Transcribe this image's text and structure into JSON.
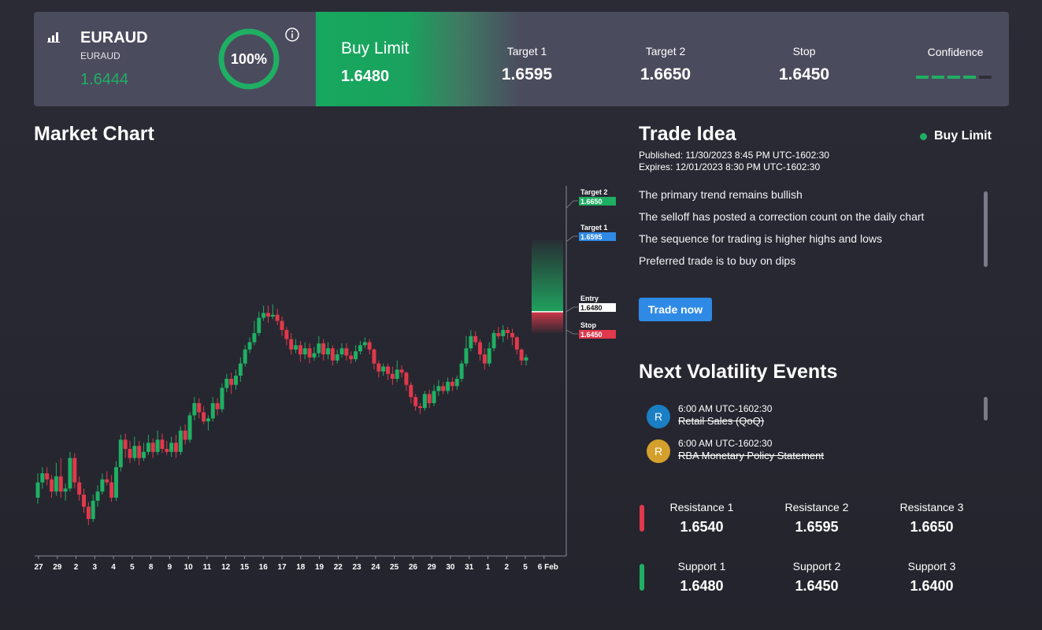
{
  "header": {
    "symbol": "EURAUD",
    "symbol_sub": "EURAUD",
    "price": "1.6444",
    "confidence_pct": "100%",
    "order_type": "Buy Limit",
    "entry": "1.6480",
    "target1_label": "Target 1",
    "target1_value": "1.6595",
    "target2_label": "Target 2",
    "target2_value": "1.6650",
    "stop_label": "Stop",
    "stop_value": "1.6450",
    "confidence_label": "Confidence",
    "confidence_segments": 5,
    "confidence_filled": 4,
    "colors": {
      "bullish": "#1faf63",
      "bearish": "#e0394b",
      "header_bg": "#4b4b5e"
    }
  },
  "market_chart": {
    "title": "Market Chart"
  },
  "chart_data": {
    "type": "candlestick",
    "x_tick_labels": [
      "27",
      "29",
      "2",
      "3",
      "4",
      "5",
      "8",
      "9",
      "10",
      "11",
      "12",
      "15",
      "16",
      "17",
      "18",
      "19",
      "22",
      "23",
      "24",
      "25",
      "26",
      "29",
      "30",
      "31",
      "1",
      "2",
      "5",
      "6 Feb"
    ],
    "y_range": [
      1.61,
      1.668
    ],
    "series": [
      {
        "o": 1.6175,
        "c": 1.62,
        "h": 1.6215,
        "l": 1.6165
      },
      {
        "o": 1.62,
        "c": 1.6215,
        "h": 1.6225,
        "l": 1.619
      },
      {
        "o": 1.6215,
        "c": 1.6205,
        "h": 1.6225,
        "l": 1.6195
      },
      {
        "o": 1.6205,
        "c": 1.6185,
        "h": 1.6212,
        "l": 1.6175
      },
      {
        "o": 1.6185,
        "c": 1.621,
        "h": 1.6232,
        "l": 1.6178
      },
      {
        "o": 1.621,
        "c": 1.6185,
        "h": 1.624,
        "l": 1.6175
      },
      {
        "o": 1.6185,
        "c": 1.619,
        "h": 1.6198,
        "l": 1.617
      },
      {
        "o": 1.619,
        "c": 1.624,
        "h": 1.625,
        "l": 1.6185
      },
      {
        "o": 1.624,
        "c": 1.62,
        "h": 1.6248,
        "l": 1.619
      },
      {
        "o": 1.62,
        "c": 1.618,
        "h": 1.621,
        "l": 1.617
      },
      {
        "o": 1.618,
        "c": 1.616,
        "h": 1.619,
        "l": 1.615
      },
      {
        "o": 1.616,
        "c": 1.614,
        "h": 1.6168,
        "l": 1.613
      },
      {
        "o": 1.614,
        "c": 1.617,
        "h": 1.618,
        "l": 1.6135
      },
      {
        "o": 1.617,
        "c": 1.6185,
        "h": 1.6195,
        "l": 1.616
      },
      {
        "o": 1.6185,
        "c": 1.6205,
        "h": 1.6215,
        "l": 1.618
      },
      {
        "o": 1.6205,
        "c": 1.62,
        "h": 1.6218,
        "l": 1.6195
      },
      {
        "o": 1.62,
        "c": 1.6175,
        "h": 1.6212,
        "l": 1.6168
      },
      {
        "o": 1.6175,
        "c": 1.6225,
        "h": 1.6235,
        "l": 1.617
      },
      {
        "o": 1.6225,
        "c": 1.627,
        "h": 1.6278,
        "l": 1.6218
      },
      {
        "o": 1.627,
        "c": 1.6255,
        "h": 1.628,
        "l": 1.624
      },
      {
        "o": 1.6255,
        "c": 1.624,
        "h": 1.6268,
        "l": 1.6232
      },
      {
        "o": 1.624,
        "c": 1.626,
        "h": 1.6275,
        "l": 1.6235
      },
      {
        "o": 1.626,
        "c": 1.624,
        "h": 1.6268,
        "l": 1.6228
      },
      {
        "o": 1.624,
        "c": 1.625,
        "h": 1.6265,
        "l": 1.6235
      },
      {
        "o": 1.625,
        "c": 1.6265,
        "h": 1.6278,
        "l": 1.6245
      },
      {
        "o": 1.6265,
        "c": 1.625,
        "h": 1.6272,
        "l": 1.624
      },
      {
        "o": 1.625,
        "c": 1.627,
        "h": 1.6285,
        "l": 1.6245
      },
      {
        "o": 1.627,
        "c": 1.6255,
        "h": 1.628,
        "l": 1.6248
      },
      {
        "o": 1.6255,
        "c": 1.625,
        "h": 1.6268,
        "l": 1.6245
      },
      {
        "o": 1.625,
        "c": 1.6265,
        "h": 1.6275,
        "l": 1.6242
      },
      {
        "o": 1.6265,
        "c": 1.625,
        "h": 1.6278,
        "l": 1.624
      },
      {
        "o": 1.625,
        "c": 1.6285,
        "h": 1.6292,
        "l": 1.6245
      },
      {
        "o": 1.6285,
        "c": 1.627,
        "h": 1.6295,
        "l": 1.6262
      },
      {
        "o": 1.627,
        "c": 1.631,
        "h": 1.6315,
        "l": 1.6265
      },
      {
        "o": 1.631,
        "c": 1.633,
        "h": 1.634,
        "l": 1.6302
      },
      {
        "o": 1.633,
        "c": 1.6315,
        "h": 1.6338,
        "l": 1.6305
      },
      {
        "o": 1.6315,
        "c": 1.63,
        "h": 1.6325,
        "l": 1.6295
      },
      {
        "o": 1.63,
        "c": 1.6305,
        "h": 1.631,
        "l": 1.6285
      },
      {
        "o": 1.6305,
        "c": 1.633,
        "h": 1.634,
        "l": 1.63
      },
      {
        "o": 1.633,
        "c": 1.632,
        "h": 1.6338,
        "l": 1.631
      },
      {
        "o": 1.632,
        "c": 1.6355,
        "h": 1.6362,
        "l": 1.6315
      },
      {
        "o": 1.6355,
        "c": 1.637,
        "h": 1.6378,
        "l": 1.6348
      },
      {
        "o": 1.637,
        "c": 1.636,
        "h": 1.638,
        "l": 1.6345
      },
      {
        "o": 1.636,
        "c": 1.6375,
        "h": 1.6385,
        "l": 1.6352
      },
      {
        "o": 1.6375,
        "c": 1.6395,
        "h": 1.6405,
        "l": 1.6365
      },
      {
        "o": 1.6395,
        "c": 1.6418,
        "h": 1.6425,
        "l": 1.639
      },
      {
        "o": 1.6418,
        "c": 1.643,
        "h": 1.6438,
        "l": 1.6412
      },
      {
        "o": 1.643,
        "c": 1.6445,
        "h": 1.6465,
        "l": 1.6425
      },
      {
        "o": 1.6445,
        "c": 1.647,
        "h": 1.648,
        "l": 1.644
      },
      {
        "o": 1.647,
        "c": 1.6478,
        "h": 1.649,
        "l": 1.6465
      },
      {
        "o": 1.6478,
        "c": 1.6472,
        "h": 1.649,
        "l": 1.6462
      },
      {
        "o": 1.6472,
        "c": 1.6475,
        "h": 1.6492,
        "l": 1.6468
      },
      {
        "o": 1.6475,
        "c": 1.6465,
        "h": 1.6485,
        "l": 1.6458
      },
      {
        "o": 1.6465,
        "c": 1.645,
        "h": 1.6472,
        "l": 1.644
      },
      {
        "o": 1.645,
        "c": 1.6435,
        "h": 1.6455,
        "l": 1.6425
      },
      {
        "o": 1.6435,
        "c": 1.6418,
        "h": 1.6445,
        "l": 1.641
      },
      {
        "o": 1.6418,
        "c": 1.6425,
        "h": 1.6435,
        "l": 1.6412
      },
      {
        "o": 1.6425,
        "c": 1.641,
        "h": 1.6432,
        "l": 1.6398
      },
      {
        "o": 1.641,
        "c": 1.642,
        "h": 1.643,
        "l": 1.6402
      },
      {
        "o": 1.642,
        "c": 1.6405,
        "h": 1.6428,
        "l": 1.6395
      },
      {
        "o": 1.6405,
        "c": 1.6412,
        "h": 1.6422,
        "l": 1.64
      },
      {
        "o": 1.6412,
        "c": 1.6428,
        "h": 1.644,
        "l": 1.6405
      },
      {
        "o": 1.6428,
        "c": 1.641,
        "h": 1.6435,
        "l": 1.64
      },
      {
        "o": 1.641,
        "c": 1.642,
        "h": 1.643,
        "l": 1.6402
      },
      {
        "o": 1.642,
        "c": 1.64,
        "h": 1.6425,
        "l": 1.6392
      },
      {
        "o": 1.64,
        "c": 1.641,
        "h": 1.6418,
        "l": 1.6395
      },
      {
        "o": 1.641,
        "c": 1.642,
        "h": 1.6428,
        "l": 1.6405
      },
      {
        "o": 1.642,
        "c": 1.6408,
        "h": 1.6428,
        "l": 1.64
      },
      {
        "o": 1.6408,
        "c": 1.6402,
        "h": 1.6415,
        "l": 1.6395
      },
      {
        "o": 1.6402,
        "c": 1.6415,
        "h": 1.6425,
        "l": 1.6398
      },
      {
        "o": 1.6415,
        "c": 1.6425,
        "h": 1.6432,
        "l": 1.641
      },
      {
        "o": 1.6425,
        "c": 1.643,
        "h": 1.6438,
        "l": 1.642
      },
      {
        "o": 1.643,
        "c": 1.6418,
        "h": 1.6435,
        "l": 1.641
      },
      {
        "o": 1.6418,
        "c": 1.6395,
        "h": 1.642,
        "l": 1.6385
      },
      {
        "o": 1.6395,
        "c": 1.6382,
        "h": 1.64,
        "l": 1.6372
      },
      {
        "o": 1.6382,
        "c": 1.639,
        "h": 1.6395,
        "l": 1.6375
      },
      {
        "o": 1.639,
        "c": 1.6378,
        "h": 1.6395,
        "l": 1.6368
      },
      {
        "o": 1.6378,
        "c": 1.637,
        "h": 1.639,
        "l": 1.636
      },
      {
        "o": 1.637,
        "c": 1.6385,
        "h": 1.64,
        "l": 1.6365
      },
      {
        "o": 1.6385,
        "c": 1.638,
        "h": 1.6392,
        "l": 1.6372
      },
      {
        "o": 1.638,
        "c": 1.636,
        "h": 1.6382,
        "l": 1.635
      },
      {
        "o": 1.636,
        "c": 1.634,
        "h": 1.6365,
        "l": 1.633
      },
      {
        "o": 1.634,
        "c": 1.6325,
        "h": 1.6345,
        "l": 1.6318
      },
      {
        "o": 1.6325,
        "c": 1.6322,
        "h": 1.633,
        "l": 1.6312
      },
      {
        "o": 1.6322,
        "c": 1.6345,
        "h": 1.635,
        "l": 1.6318
      },
      {
        "o": 1.6345,
        "c": 1.633,
        "h": 1.6352,
        "l": 1.6322
      },
      {
        "o": 1.633,
        "c": 1.635,
        "h": 1.636,
        "l": 1.6325
      },
      {
        "o": 1.635,
        "c": 1.6358,
        "h": 1.6368,
        "l": 1.6342
      },
      {
        "o": 1.6358,
        "c": 1.635,
        "h": 1.6365,
        "l": 1.6345
      },
      {
        "o": 1.635,
        "c": 1.6365,
        "h": 1.6372,
        "l": 1.6345
      },
      {
        "o": 1.6365,
        "c": 1.6358,
        "h": 1.6372,
        "l": 1.635
      },
      {
        "o": 1.6358,
        "c": 1.637,
        "h": 1.6375,
        "l": 1.6352
      },
      {
        "o": 1.637,
        "c": 1.6395,
        "h": 1.64,
        "l": 1.6365
      },
      {
        "o": 1.6395,
        "c": 1.642,
        "h": 1.644,
        "l": 1.639
      },
      {
        "o": 1.642,
        "c": 1.644,
        "h": 1.645,
        "l": 1.6415
      },
      {
        "o": 1.644,
        "c": 1.643,
        "h": 1.6448,
        "l": 1.6425
      },
      {
        "o": 1.643,
        "c": 1.641,
        "h": 1.6435,
        "l": 1.64
      },
      {
        "o": 1.641,
        "c": 1.6395,
        "h": 1.642,
        "l": 1.6385
      },
      {
        "o": 1.6395,
        "c": 1.642,
        "h": 1.643,
        "l": 1.639
      },
      {
        "o": 1.642,
        "c": 1.6445,
        "h": 1.645,
        "l": 1.6415
      },
      {
        "o": 1.6445,
        "c": 1.644,
        "h": 1.6455,
        "l": 1.6435
      },
      {
        "o": 1.644,
        "c": 1.645,
        "h": 1.6458,
        "l": 1.643
      },
      {
        "o": 1.645,
        "c": 1.6445,
        "h": 1.6455,
        "l": 1.6435
      },
      {
        "o": 1.6445,
        "c": 1.6438,
        "h": 1.6452,
        "l": 1.6425
      },
      {
        "o": 1.6438,
        "c": 1.6418,
        "h": 1.644,
        "l": 1.641
      },
      {
        "o": 1.6418,
        "c": 1.64,
        "h": 1.642,
        "l": 1.6392
      },
      {
        "o": 1.64,
        "c": 1.6405,
        "h": 1.641,
        "l": 1.6392
      }
    ],
    "levels": [
      {
        "name": "Target 2",
        "value": "1.6650",
        "color": "#1faf63"
      },
      {
        "name": "Target 1",
        "value": "1.6595",
        "color": "#2f8ae6"
      },
      {
        "name": "Entry",
        "value": "1.6480",
        "color": "#ffffff"
      },
      {
        "name": "Stop",
        "value": "1.6450",
        "color": "#e0394b"
      }
    ]
  },
  "trade_idea": {
    "title": "Trade Idea",
    "status": "Buy Limit",
    "published_label": "Published:",
    "published_value": "11/30/2023 8:45 PM UTC-1602:30",
    "expires_label": "Expires:",
    "expires_value": "12/01/2023 8:30 PM UTC-1602:30",
    "points": [
      "The primary trend remains bullish",
      "The selloff has posted a correction count on the daily chart",
      "The sequence for trading is higher highs and lows",
      "Preferred trade is to buy on dips"
    ],
    "button_label": "Trade now"
  },
  "volatility": {
    "title": "Next Volatility Events",
    "events": [
      {
        "badge": "R",
        "time": "6:00 AM UTC-1602:30",
        "name": "Retail Sales (QoQ)",
        "color": "#1a7fc4"
      },
      {
        "badge": "R",
        "time": "6:00 AM UTC-1602:30",
        "name": "RBA Monetary Policy Statement",
        "color": "#d4a02c"
      }
    ]
  },
  "levels": {
    "resistance": [
      {
        "label": "Resistance 1",
        "value": "1.6540"
      },
      {
        "label": "Resistance 2",
        "value": "1.6595"
      },
      {
        "label": "Resistance 3",
        "value": "1.6650"
      }
    ],
    "support": [
      {
        "label": "Support 1",
        "value": "1.6480"
      },
      {
        "label": "Support 2",
        "value": "1.6450"
      },
      {
        "label": "Support 3",
        "value": "1.6400"
      }
    ]
  }
}
